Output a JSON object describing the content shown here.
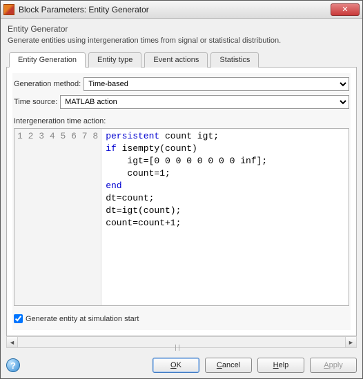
{
  "window": {
    "title": "Block Parameters: Entity Generator"
  },
  "header": {
    "title": "Entity Generator",
    "description": "Generate entities using intergeneration times from signal or statistical distribution."
  },
  "tabs": {
    "items": [
      {
        "label": "Entity Generation"
      },
      {
        "label": "Entity type"
      },
      {
        "label": "Event actions"
      },
      {
        "label": "Statistics"
      }
    ]
  },
  "form": {
    "generation_method_label": "Generation method:",
    "generation_method_value": "Time-based",
    "time_source_label": "Time source:",
    "time_source_value": "MATLAB action",
    "intergen_label": "Intergeneration time action:"
  },
  "code": {
    "lines": [
      {
        "n": "1",
        "pre": "",
        "kw": "persistent",
        "rest": " count igt;"
      },
      {
        "n": "2",
        "pre": "",
        "kw": "if",
        "rest": " isempty(count)"
      },
      {
        "n": "3",
        "pre": "    igt=[0 0 0 0 0 0 0 0 inf];",
        "kw": "",
        "rest": ""
      },
      {
        "n": "4",
        "pre": "    count=1;",
        "kw": "",
        "rest": ""
      },
      {
        "n": "5",
        "pre": "",
        "kw": "end",
        "rest": ""
      },
      {
        "n": "6",
        "pre": "dt=count;",
        "kw": "",
        "rest": ""
      },
      {
        "n": "7",
        "pre": "dt=igt(count);",
        "kw": "",
        "rest": ""
      },
      {
        "n": "8",
        "pre": "count=count+1;",
        "kw": "",
        "rest": ""
      }
    ]
  },
  "checkbox": {
    "label": "Generate entity at simulation start",
    "checked": true
  },
  "buttons": {
    "ok_u": "O",
    "ok_rest": "K",
    "cancel_u": "C",
    "cancel_rest": "ancel",
    "help_u": "H",
    "help_rest": "elp",
    "apply_u": "A",
    "apply_rest": "pply"
  }
}
